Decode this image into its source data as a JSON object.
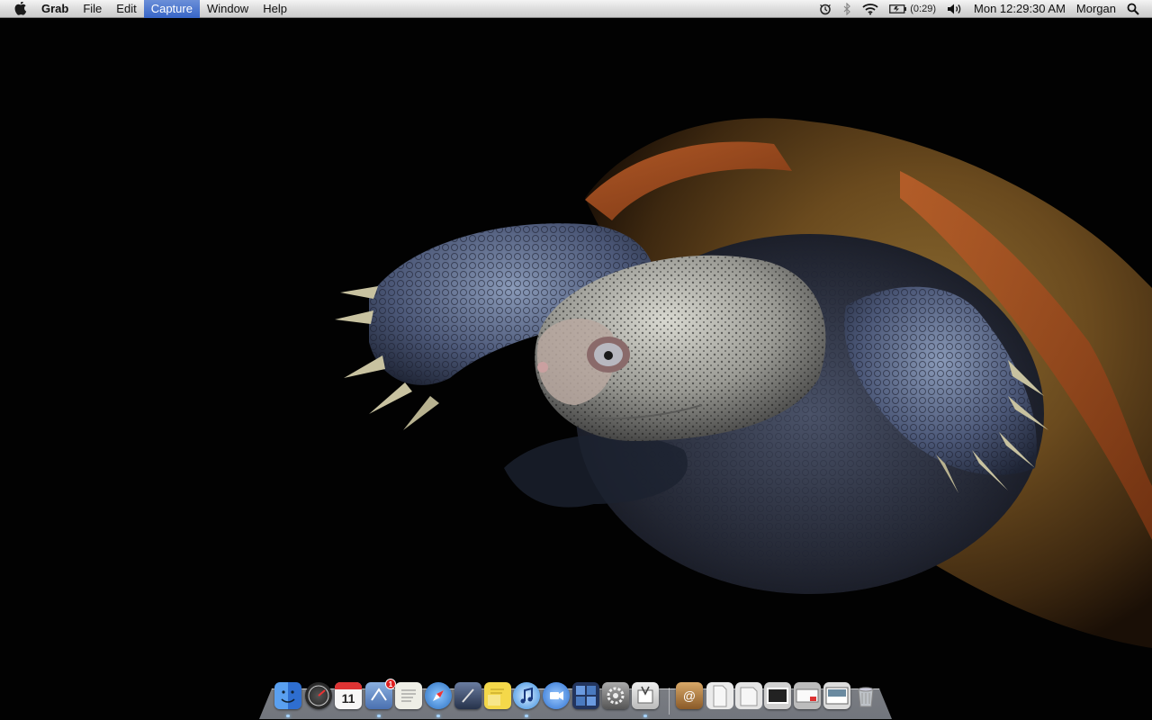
{
  "menubar": {
    "app_name": "Grab",
    "menus": [
      "File",
      "Edit",
      "Capture",
      "Window",
      "Help"
    ],
    "active_menu": "Capture",
    "battery_time": "(0:29)",
    "clock": "Mon 12:29:30 AM",
    "user": "Morgan",
    "status_icons": [
      "time-machine-icon",
      "bluetooth-icon",
      "wifi-icon",
      "battery-icon",
      "volume-icon",
      "spotlight-icon"
    ]
  },
  "dock": {
    "calendar_day": "11",
    "mail_badge": "1",
    "items": [
      {
        "name": "finder",
        "color": "#3b7de0"
      },
      {
        "name": "dashboard",
        "color": "#2a2a2a"
      },
      {
        "name": "ical",
        "color": "#f2f2f2"
      },
      {
        "name": "mail",
        "color": "#5a86c8"
      },
      {
        "name": "textedit",
        "color": "#e8e8e0"
      },
      {
        "name": "safari",
        "color": "#3a8ad6"
      },
      {
        "name": "script-editor",
        "color": "#3d4e70"
      },
      {
        "name": "stickies",
        "color": "#f4d84a"
      },
      {
        "name": "itunes",
        "color": "#4aa0e8"
      },
      {
        "name": "ichat",
        "color": "#3d8be0"
      },
      {
        "name": "spaces",
        "color": "#3a5a9a"
      },
      {
        "name": "system-preferences",
        "color": "#8d8d8d"
      },
      {
        "name": "grab",
        "color": "#d8d8d8"
      },
      {
        "name": "address-book",
        "color": "#c09050"
      },
      {
        "name": "pages-document",
        "color": "#eaeaea"
      },
      {
        "name": "pages-document-2",
        "color": "#e4e4e4"
      },
      {
        "name": "preview-stack",
        "color": "#d0d0d0"
      },
      {
        "name": "screenshot-stack",
        "color": "#bcbcbc"
      },
      {
        "name": "downloads-stack",
        "color": "#dcdcdc"
      },
      {
        "name": "trash",
        "color": "#c8ccd0"
      }
    ]
  }
}
